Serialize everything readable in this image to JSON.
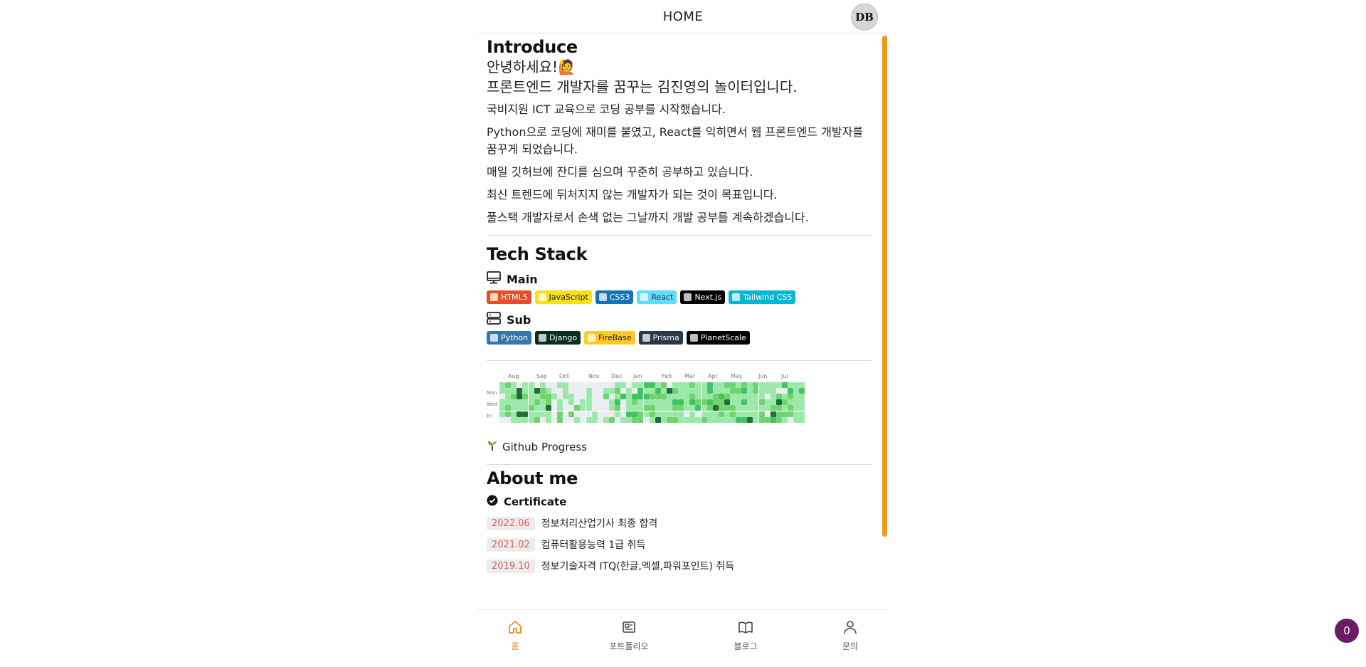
{
  "header": {
    "title": "HOME",
    "avatar_text": "DB"
  },
  "introduce": {
    "heading": "Introduce",
    "greeting_line1": "안녕하세요!",
    "greeting_emoji": "🙋",
    "greeting_line2": "프론트엔드 개발자를 꿈꾸는 김진영의 놀이터입니다.",
    "paragraphs": [
      "국비지원 ICT 교육으로 코딩 공부를 시작했습니다.",
      "Python으로 코딩에 재미를 붙였고, React를 익히면서 웹 프론트엔드 개발자를 꿈꾸게 되었습니다.",
      "매일 깃허브에 잔디를 심으며 꾸준히 공부하고 있습니다.",
      "최신 트렌드에 뒤처지지 않는 개발자가 되는 것이 목표입니다.",
      "풀스택 개발자로서 손색 없는 그날까지 개발 공부를 계속하겠습니다."
    ]
  },
  "tech_stack": {
    "heading": "Tech Stack",
    "main_label": "Main",
    "main_badges": [
      {
        "label": "HTML5",
        "color": "#e34f26",
        "text_color": "#ffffff"
      },
      {
        "label": "JavaScript",
        "color": "#f7df1e",
        "text_color": "#222222"
      },
      {
        "label": "CSS3",
        "color": "#1572b6",
        "text_color": "#ffffff"
      },
      {
        "label": "React",
        "color": "#61dafb",
        "text_color": "#1e3a4c"
      },
      {
        "label": "Next.js",
        "color": "#000000",
        "text_color": "#ffffff"
      },
      {
        "label": "Tailwind CSS",
        "color": "#06b6d4",
        "text_color": "#ffffff"
      }
    ],
    "sub_label": "Sub",
    "sub_badges": [
      {
        "label": "Python",
        "color": "#3776ab",
        "text_color": "#ffffff"
      },
      {
        "label": "Django",
        "color": "#092e20",
        "text_color": "#ffffff"
      },
      {
        "label": "FireBase",
        "color": "#ffca28",
        "text_color": "#222222"
      },
      {
        "label": "Prisma",
        "color": "#2d3748",
        "text_color": "#ffffff"
      },
      {
        "label": "PlanetScale",
        "color": "#000000",
        "text_color": "#ffffff"
      }
    ]
  },
  "github": {
    "months": [
      "Aug",
      "Sep",
      "Oct",
      "Nov",
      "Dec",
      "Jan",
      "Feb",
      "Mar",
      "Apr",
      "May",
      "Jun",
      "Jul"
    ],
    "days": [
      "Mon",
      "Wed",
      "Fri"
    ],
    "label": "Github Progress",
    "colors": {
      "empty": "#ebedf0",
      "level1": "#9be9a8",
      "level2": "#6fd36f",
      "level3": "#40c463",
      "level4": "#216e39"
    }
  },
  "about": {
    "heading": "About me",
    "certificate_label": "Certificate",
    "certificates": [
      {
        "date": "2022.06",
        "text": "정보처리산업기사 최종 합격"
      },
      {
        "date": "2021.02",
        "text": "컴퓨터활용능력 1급 취득"
      },
      {
        "date": "2019.10",
        "text": "정보기술자격 ITQ(한글,엑셀,파워포인트) 취득"
      }
    ]
  },
  "bottom_nav": [
    {
      "label": "홈",
      "icon": "home-icon",
      "active": true
    },
    {
      "label": "포트폴리오",
      "icon": "newspaper-icon",
      "active": false
    },
    {
      "label": "블로그",
      "icon": "book-icon",
      "active": false
    },
    {
      "label": "문의",
      "icon": "user-icon",
      "active": false
    }
  ],
  "fab": {
    "count": "0"
  },
  "accent": "#ea8a16"
}
